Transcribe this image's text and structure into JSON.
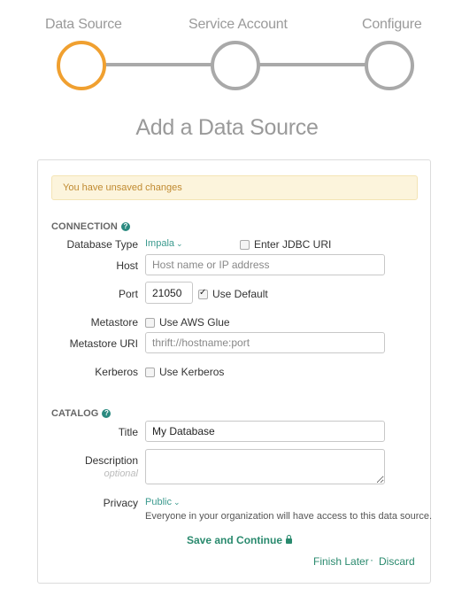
{
  "wizard": {
    "steps": [
      {
        "label": "Data Source",
        "active": true
      },
      {
        "label": "Service Account",
        "active": false
      },
      {
        "label": "Configure",
        "active": false
      }
    ],
    "active_color": "#f0a030",
    "inactive_color": "#a9a9a9"
  },
  "page_title": "Add a Data Source",
  "alert": {
    "text": "You have unsaved changes"
  },
  "connection": {
    "heading": "CONNECTION",
    "database_type": {
      "label": "Database Type",
      "value": "Impala"
    },
    "jdbc": {
      "label": "Enter JDBC URI",
      "checked": false
    },
    "host": {
      "label": "Host",
      "placeholder": "Host name or IP address",
      "value": ""
    },
    "port": {
      "label": "Port",
      "value": "21050",
      "use_default_label": "Use Default",
      "use_default_checked": true
    },
    "metastore": {
      "label": "Metastore",
      "option_label": "Use AWS Glue",
      "checked": false
    },
    "metastore_uri": {
      "label": "Metastore URI",
      "placeholder": "thrift://hostname:port",
      "value": ""
    },
    "kerberos": {
      "label": "Kerberos",
      "option_label": "Use Kerberos",
      "checked": false
    }
  },
  "catalog": {
    "heading": "CATALOG",
    "title": {
      "label": "Title",
      "value": "My Database"
    },
    "description": {
      "label": "Description",
      "sublabel": "optional",
      "value": ""
    },
    "privacy": {
      "label": "Privacy",
      "value": "Public",
      "help": "Everyone in your organization will have access to this data source."
    }
  },
  "actions": {
    "save_continue": "Save and Continue",
    "finish_later": "Finish Later",
    "separator": "·",
    "discard": "Discard"
  },
  "colors": {
    "accent": "#2a8a6e",
    "warning_bg": "#fcf4dc",
    "warning_text": "#c08a30"
  }
}
